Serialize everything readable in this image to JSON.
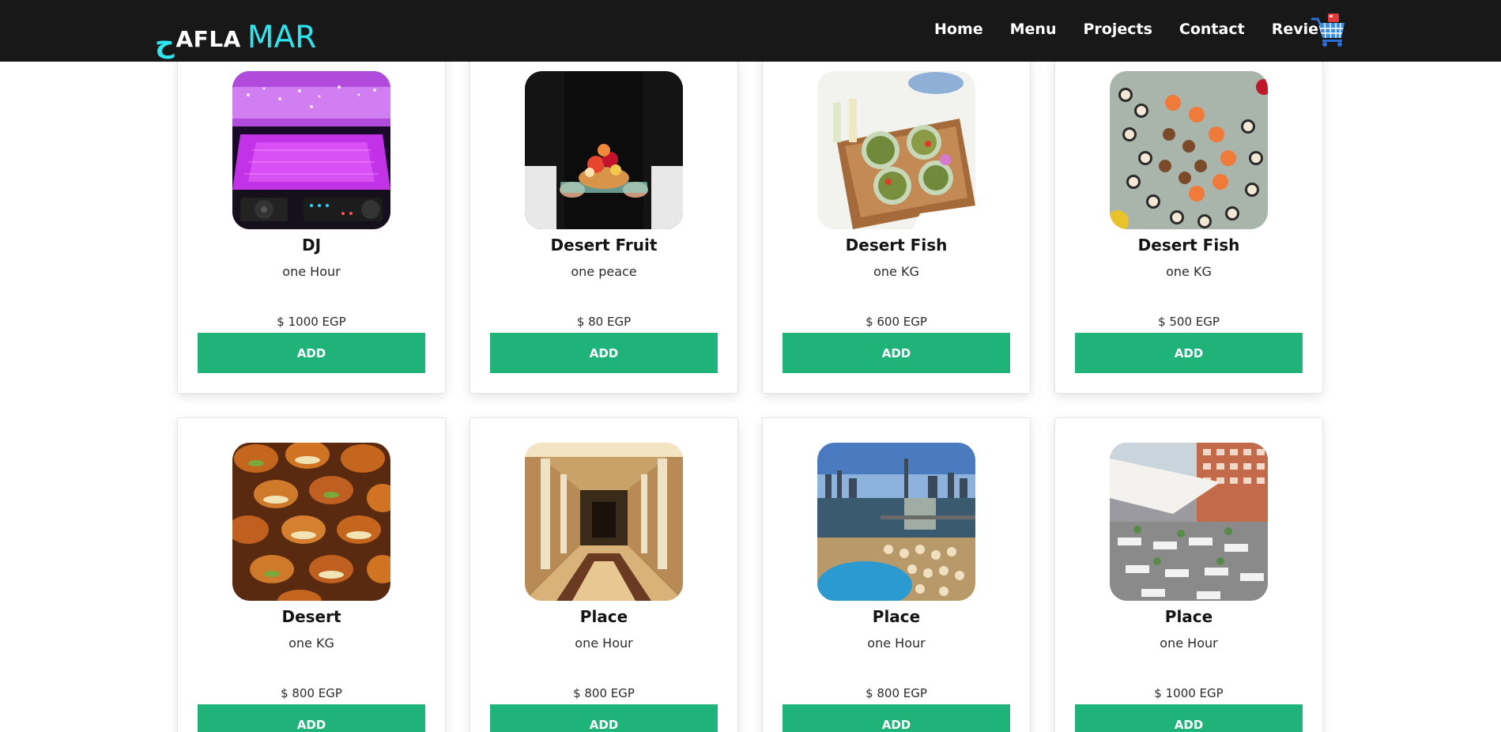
{
  "brand": {
    "arabic_part": "ح",
    "latin_part": "AFLA",
    "accent_part": "MAR"
  },
  "nav": {
    "items": [
      {
        "label": "Home"
      },
      {
        "label": "Menu"
      },
      {
        "label": "Projects"
      },
      {
        "label": "Contact"
      },
      {
        "label": "Review"
      }
    ],
    "cart_icon": "shopping-cart-icon"
  },
  "colors": {
    "navbar_bg": "#181818",
    "brand_accent": "#2ee6f0",
    "add_button": "#1fb37a"
  },
  "products": [
    {
      "name": "DJ",
      "unit": "one Hour",
      "price": "$ 1000 EGP",
      "button": "ADD",
      "image": "dj-light-show"
    },
    {
      "name": "Desert Fruit",
      "unit": "one peace",
      "price": "$ 80 EGP",
      "button": "ADD",
      "image": "fruit-tart-tray"
    },
    {
      "name": "Desert Fish",
      "unit": "one KG",
      "price": "$ 600 EGP",
      "button": "ADD",
      "image": "fish-bowls-tray"
    },
    {
      "name": "Desert Fish",
      "unit": "one KG",
      "price": "$ 500 EGP",
      "button": "ADD",
      "image": "sushi-platter"
    },
    {
      "name": "Desert",
      "unit": "one KG",
      "price": "$ 800 EGP",
      "button": "ADD",
      "image": "mini-sandwiches"
    },
    {
      "name": "Place",
      "unit": "one Hour",
      "price": "$ 800 EGP",
      "button": "ADD",
      "image": "marble-hallway"
    },
    {
      "name": "Place",
      "unit": "one Hour",
      "price": "$ 800 EGP",
      "button": "ADD",
      "image": "nile-terrace-venue"
    },
    {
      "name": "Place",
      "unit": "one Hour",
      "price": "$ 1000 EGP",
      "button": "ADD",
      "image": "outdoor-wedding-setup"
    }
  ]
}
